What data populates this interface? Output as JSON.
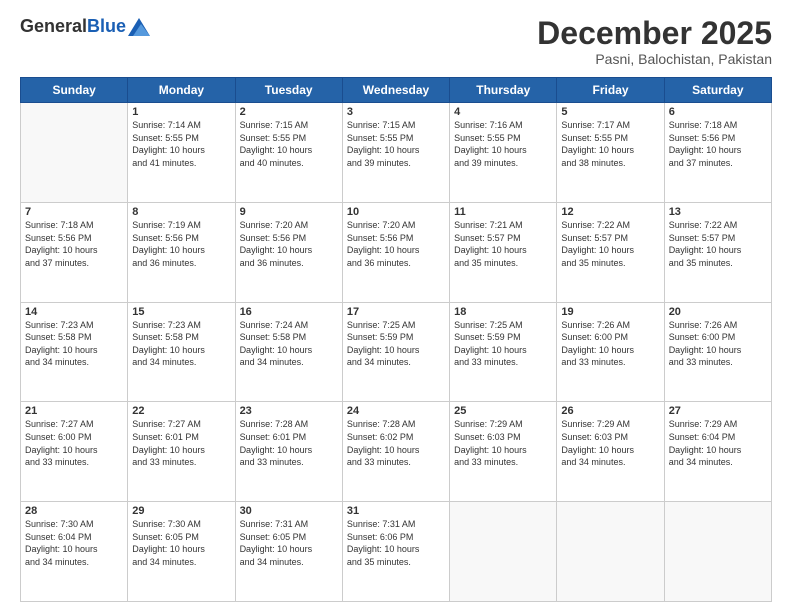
{
  "header": {
    "logo_general": "General",
    "logo_blue": "Blue",
    "month_title": "December 2025",
    "subtitle": "Pasni, Balochistan, Pakistan"
  },
  "days_of_week": [
    "Sunday",
    "Monday",
    "Tuesday",
    "Wednesday",
    "Thursday",
    "Friday",
    "Saturday"
  ],
  "weeks": [
    [
      {
        "day": "",
        "info": ""
      },
      {
        "day": "1",
        "info": "Sunrise: 7:14 AM\nSunset: 5:55 PM\nDaylight: 10 hours\nand 41 minutes."
      },
      {
        "day": "2",
        "info": "Sunrise: 7:15 AM\nSunset: 5:55 PM\nDaylight: 10 hours\nand 40 minutes."
      },
      {
        "day": "3",
        "info": "Sunrise: 7:15 AM\nSunset: 5:55 PM\nDaylight: 10 hours\nand 39 minutes."
      },
      {
        "day": "4",
        "info": "Sunrise: 7:16 AM\nSunset: 5:55 PM\nDaylight: 10 hours\nand 39 minutes."
      },
      {
        "day": "5",
        "info": "Sunrise: 7:17 AM\nSunset: 5:55 PM\nDaylight: 10 hours\nand 38 minutes."
      },
      {
        "day": "6",
        "info": "Sunrise: 7:18 AM\nSunset: 5:56 PM\nDaylight: 10 hours\nand 37 minutes."
      }
    ],
    [
      {
        "day": "7",
        "info": "Sunrise: 7:18 AM\nSunset: 5:56 PM\nDaylight: 10 hours\nand 37 minutes."
      },
      {
        "day": "8",
        "info": "Sunrise: 7:19 AM\nSunset: 5:56 PM\nDaylight: 10 hours\nand 36 minutes."
      },
      {
        "day": "9",
        "info": "Sunrise: 7:20 AM\nSunset: 5:56 PM\nDaylight: 10 hours\nand 36 minutes."
      },
      {
        "day": "10",
        "info": "Sunrise: 7:20 AM\nSunset: 5:56 PM\nDaylight: 10 hours\nand 36 minutes."
      },
      {
        "day": "11",
        "info": "Sunrise: 7:21 AM\nSunset: 5:57 PM\nDaylight: 10 hours\nand 35 minutes."
      },
      {
        "day": "12",
        "info": "Sunrise: 7:22 AM\nSunset: 5:57 PM\nDaylight: 10 hours\nand 35 minutes."
      },
      {
        "day": "13",
        "info": "Sunrise: 7:22 AM\nSunset: 5:57 PM\nDaylight: 10 hours\nand 35 minutes."
      }
    ],
    [
      {
        "day": "14",
        "info": "Sunrise: 7:23 AM\nSunset: 5:58 PM\nDaylight: 10 hours\nand 34 minutes."
      },
      {
        "day": "15",
        "info": "Sunrise: 7:23 AM\nSunset: 5:58 PM\nDaylight: 10 hours\nand 34 minutes."
      },
      {
        "day": "16",
        "info": "Sunrise: 7:24 AM\nSunset: 5:58 PM\nDaylight: 10 hours\nand 34 minutes."
      },
      {
        "day": "17",
        "info": "Sunrise: 7:25 AM\nSunset: 5:59 PM\nDaylight: 10 hours\nand 34 minutes."
      },
      {
        "day": "18",
        "info": "Sunrise: 7:25 AM\nSunset: 5:59 PM\nDaylight: 10 hours\nand 33 minutes."
      },
      {
        "day": "19",
        "info": "Sunrise: 7:26 AM\nSunset: 6:00 PM\nDaylight: 10 hours\nand 33 minutes."
      },
      {
        "day": "20",
        "info": "Sunrise: 7:26 AM\nSunset: 6:00 PM\nDaylight: 10 hours\nand 33 minutes."
      }
    ],
    [
      {
        "day": "21",
        "info": "Sunrise: 7:27 AM\nSunset: 6:00 PM\nDaylight: 10 hours\nand 33 minutes."
      },
      {
        "day": "22",
        "info": "Sunrise: 7:27 AM\nSunset: 6:01 PM\nDaylight: 10 hours\nand 33 minutes."
      },
      {
        "day": "23",
        "info": "Sunrise: 7:28 AM\nSunset: 6:01 PM\nDaylight: 10 hours\nand 33 minutes."
      },
      {
        "day": "24",
        "info": "Sunrise: 7:28 AM\nSunset: 6:02 PM\nDaylight: 10 hours\nand 33 minutes."
      },
      {
        "day": "25",
        "info": "Sunrise: 7:29 AM\nSunset: 6:03 PM\nDaylight: 10 hours\nand 33 minutes."
      },
      {
        "day": "26",
        "info": "Sunrise: 7:29 AM\nSunset: 6:03 PM\nDaylight: 10 hours\nand 34 minutes."
      },
      {
        "day": "27",
        "info": "Sunrise: 7:29 AM\nSunset: 6:04 PM\nDaylight: 10 hours\nand 34 minutes."
      }
    ],
    [
      {
        "day": "28",
        "info": "Sunrise: 7:30 AM\nSunset: 6:04 PM\nDaylight: 10 hours\nand 34 minutes."
      },
      {
        "day": "29",
        "info": "Sunrise: 7:30 AM\nSunset: 6:05 PM\nDaylight: 10 hours\nand 34 minutes."
      },
      {
        "day": "30",
        "info": "Sunrise: 7:31 AM\nSunset: 6:05 PM\nDaylight: 10 hours\nand 34 minutes."
      },
      {
        "day": "31",
        "info": "Sunrise: 7:31 AM\nSunset: 6:06 PM\nDaylight: 10 hours\nand 35 minutes."
      },
      {
        "day": "",
        "info": ""
      },
      {
        "day": "",
        "info": ""
      },
      {
        "day": "",
        "info": ""
      }
    ]
  ]
}
